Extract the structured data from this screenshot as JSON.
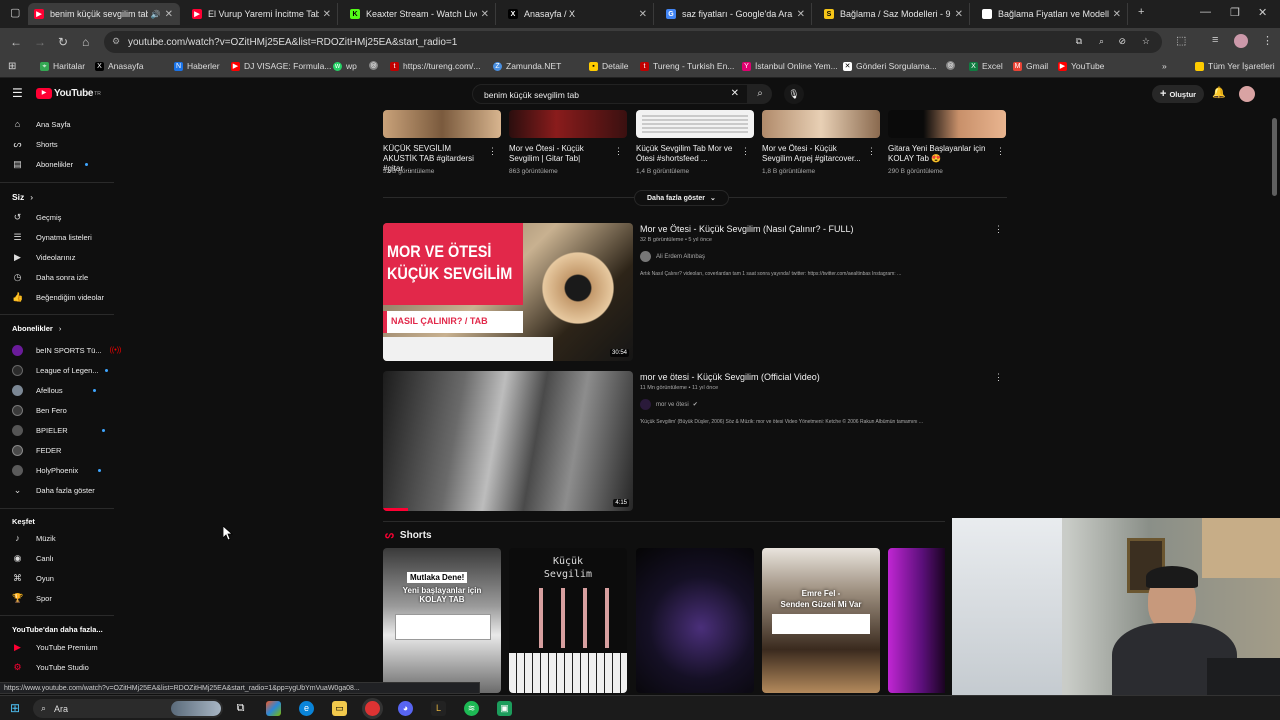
{
  "browser": {
    "tabs": [
      {
        "title": "benim küçük sevgilim tab -",
        "icon_color": "#ff0033"
      },
      {
        "title": "El Vurup Yaremi İncitme Tabip (",
        "icon_color": "#ff0033"
      },
      {
        "title": "Keaxter Stream - Watch Live o",
        "icon_color": "#53fc18"
      },
      {
        "title": "Anasayfa / X",
        "icon_color": "#000000"
      },
      {
        "title": "saz fiyatları - Google'da Ara",
        "icon_color": "#4285f4"
      },
      {
        "title": "Bağlama / Saz Modelleri - 9",
        "icon_color": "#f5c518"
      },
      {
        "title": "Bağlama Fiyatları ve Modelleri",
        "icon_color": "#ffffff"
      }
    ],
    "url": "youtube.com/watch?v=OZitHMj25EA&list=RDOZitHMj25EA&start_radio=1",
    "bookmarks": [
      {
        "label": "Haritalar",
        "color": "#34a853"
      },
      {
        "label": "Anasayfa",
        "color": "#000000"
      },
      {
        "label": "Haberler",
        "color": "#1a73e8"
      },
      {
        "label": "DJ VISAGE: Formula...",
        "color": "#ff0000"
      },
      {
        "label": "wp",
        "color": "#25d366"
      },
      {
        "label": "",
        "color": "#888888"
      },
      {
        "label": "https://tureng.com/...",
        "color": "#c00000"
      },
      {
        "label": "Zamunda.NET",
        "color": "#4a90e2"
      },
      {
        "label": "Detaile",
        "color": "#ffcc00"
      },
      {
        "label": "Tureng - Turkish En...",
        "color": "#c00000"
      },
      {
        "label": "İstanbul Online Yem...",
        "color": "#e00070"
      },
      {
        "label": "Gönderi Sorgulama...",
        "color": "#ffffff"
      },
      {
        "label": "",
        "color": "#888888"
      },
      {
        "label": "Excel",
        "color": "#107c41"
      },
      {
        "label": "Gmail",
        "color": "#ea4335"
      },
      {
        "label": "YouTube",
        "color": "#ff0000"
      }
    ],
    "bookmarks_all": "Tüm Yer İşaretleri",
    "status_url": "https://www.youtube.com/watch?v=OZitHMj25EA&list=RDOZitHMj25EA&start_radio=1&pp=ygUbYmVuaW0ga08..."
  },
  "youtube": {
    "logo": "YouTube",
    "logo_sup": "TR",
    "search_value": "benim küçük sevgilim tab",
    "create_label": "Oluştur",
    "sidebar": {
      "main": [
        "Ana Sayfa",
        "Shorts",
        "Abonelikler"
      ],
      "you_header": "Siz",
      "you": [
        "Geçmiş",
        "Oynatma listeleri",
        "Videolarınız",
        "Daha sonra izle",
        "Beğendiğim videolar"
      ],
      "subs_header": "Abonelikler",
      "subs": [
        {
          "name": "beIN SPORTS Tü...",
          "color": "#6a1b9a",
          "badge": "live"
        },
        {
          "name": "League of Legen...",
          "color": "#2b2b2b",
          "badge": "dot"
        },
        {
          "name": "Afellous",
          "color": "#7b8794",
          "badge": "dot"
        },
        {
          "name": "Ben Fero",
          "color": "#3a3a3a",
          "badge": ""
        },
        {
          "name": "BPIELER",
          "color": "#555555",
          "badge": "dot"
        },
        {
          "name": "FEDER",
          "color": "#4a4a4a",
          "badge": ""
        },
        {
          "name": "HolyPhoenix",
          "color": "#5a5a5a",
          "badge": "dot"
        }
      ],
      "show_more": "Daha fazla göster",
      "explore_header": "Keşfet",
      "explore": [
        "Müzik",
        "Canlı",
        "Oyun",
        "Spor"
      ],
      "more_header": "YouTube'dan daha fazla...",
      "more": [
        "YouTube Premium",
        "YouTube Studio"
      ]
    },
    "top_row": [
      {
        "title": "KÜÇÜK SEVGİLİM AKUSTİK TAB #gitardersi #gitar ...",
        "views": "32 B görüntüleme"
      },
      {
        "title": "Mor ve Ötesi - Küçük Sevgilim | Gitar Tab|",
        "views": "863 görüntüleme"
      },
      {
        "title": "Küçük Sevgilim Tab Mor ve Ötesi  #shortsfeed ...",
        "views": "1,4 B görüntüleme"
      },
      {
        "title": "Mor ve Ötesi - Küçük Sevgilim Arpej #gitarcover...",
        "views": "1,8 B görüntüleme"
      },
      {
        "title": "Gitara Yeni Başlayanlar için KOLAY Tab 😍",
        "views": "290 B görüntüleme"
      }
    ],
    "show_more_results": "Daha fazla göster",
    "videos": [
      {
        "title": "Mor ve Ötesi - Küçük Sevgilim (Nasıl Çalınır? - FULL)",
        "meta": "32 B görüntüleme • 5 yıl önce",
        "channel": "Ali Erdem Altınbaş",
        "desc": "Artık Nasıl Çalınır? videoları, coverlardan tam 1 saat sonra yayında! twitter: https://twitter.com/aealtinbas Instagram: ...",
        "duration": "30:54",
        "thumb_line1": "MOR VE ÖTESİ",
        "thumb_line2": "KÜÇÜK SEVGİLİM",
        "thumb_badge": "NASIL ÇALINIR? / TAB"
      },
      {
        "title": "mor ve ötesi - Küçük Sevgilim (Official Video)",
        "meta": "11 Mn görüntüleme • 11 yıl önce",
        "channel": "mor ve ötesi",
        "desc": "'Küçük Sevgilim' (Büyük Düşler, 2006) Söz & Müzik: mor ve ötesi Video Yönetmeni: Ketche © 2006 Rakun Albümün tamamını ...",
        "duration": "4:15"
      }
    ],
    "shorts_header": "Shorts",
    "shorts": [
      {
        "l1": "Mutlaka Dene!",
        "l2": "Yeni başlayanlar için KOLAY TAB"
      },
      {
        "l1": "Küçük",
        "l2": "Sevgilim"
      },
      {
        "l1": "",
        "l2": ""
      },
      {
        "l1": "Emre Fel -",
        "l2": "Senden Güzeli Mi Var"
      },
      {
        "l1": "",
        "l2": ""
      }
    ]
  },
  "taskbar": {
    "search": "Ara"
  }
}
